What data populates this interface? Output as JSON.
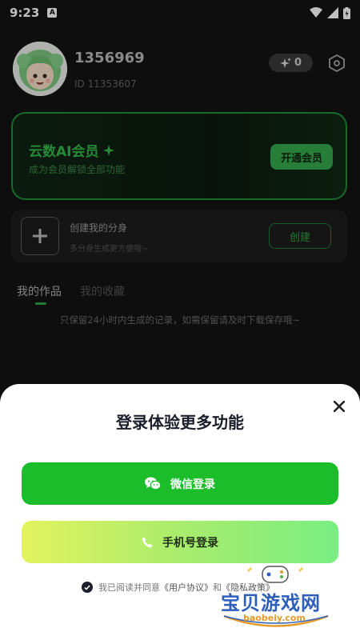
{
  "status_bar": {
    "time": "9:23",
    "notification_letter": "A"
  },
  "profile": {
    "username": "1356969",
    "user_id": "ID 11353607",
    "points": "0"
  },
  "vip": {
    "title": "云数AI会员",
    "subtitle": "成为会员解锁全部功能",
    "button": "开通会员"
  },
  "create_avatar": {
    "title": "创建我的分身",
    "subtitle": "多分身生成更方便哦~",
    "button": "创建"
  },
  "tabs": {
    "works": "我的作品",
    "favorites": "我的收藏"
  },
  "notice": "只保留24小时内生成的记录，如需保留请及时下载保存哦~",
  "login_sheet": {
    "title": "登录体验更多功能",
    "wechat_button": "微信登录",
    "phone_button": "手机号登录",
    "agreement_prefix": "我已阅读并同意",
    "user_agreement": "《用户协议》",
    "and": "和",
    "privacy_policy": "《隐私政策》"
  },
  "watermark": {
    "text": "宝贝游戏网",
    "domain": "baobeiy.com"
  },
  "colors": {
    "accent_green": "#35b84a",
    "wechat_green": "#1cbd2b",
    "background": "#131313",
    "sheet": "#ffffff"
  }
}
